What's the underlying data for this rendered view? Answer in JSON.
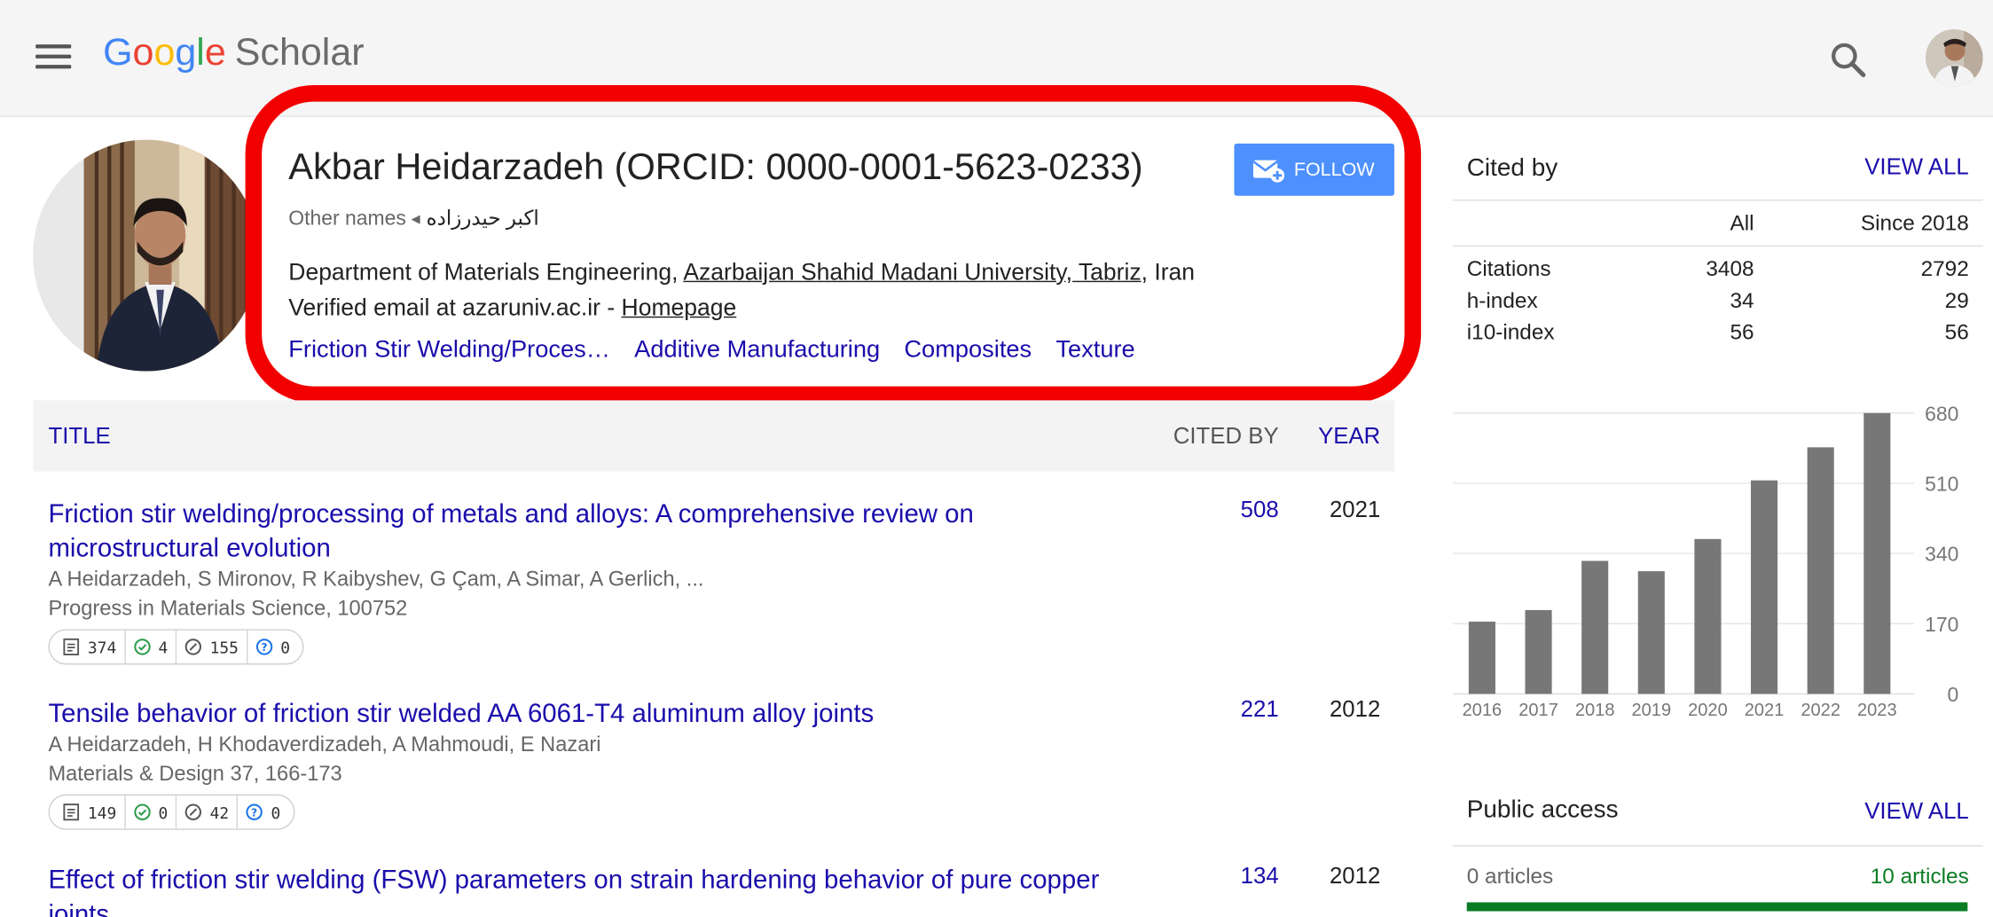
{
  "header": {
    "brand_letters": [
      "G",
      "o",
      "o",
      "g",
      "l",
      "e"
    ],
    "brand_colors": [
      "#4285f4",
      "#ea4335",
      "#fbbc05",
      "#4285f4",
      "#34a853",
      "#ea4335"
    ],
    "product": "Scholar",
    "menu_icon": "hamburger-menu-icon",
    "search_icon": "search-icon",
    "avatar": "user-avatar"
  },
  "profile": {
    "name": "Akbar Heidarzadeh (ORCID: 0000-0001-5623-0233)",
    "follow_label": "FOLLOW",
    "other_names_label": "Other names",
    "other_name": "اکبر حیدرزاده",
    "affiliation_prefix": "Department of Materials Engineering, ",
    "affiliation_link": "Azarbaijan Shahid Madani University, Tabriz",
    "affiliation_suffix": ", Iran",
    "verified_text": "Verified email at azaruniv.ac.ir - ",
    "homepage_label": "Homepage",
    "interests": [
      "Friction Stir Welding/Proces…",
      "Additive Manufacturing",
      "Composites",
      "Texture"
    ],
    "highlight_color": "#f20000"
  },
  "table": {
    "col_title": "TITLE",
    "col_cited": "CITED BY",
    "col_year": "YEAR"
  },
  "articles": [
    {
      "title": "Friction stir welding/processing of metals and alloys: A comprehensive review on microstructural evolution",
      "authors": "A Heidarzadeh, S Mironov, R Kaibyshev, G Çam, A Simar, A Gerlich, ...",
      "journal": "Progress in Materials Science, 100752",
      "cited": "508",
      "year": "2021",
      "badges": [
        "374",
        "4",
        "155",
        "0"
      ]
    },
    {
      "title": "Tensile behavior of friction stir welded AA 6061-T4 aluminum alloy joints",
      "authors": "A Heidarzadeh, H Khodaverdizadeh, A Mahmoudi, E Nazari",
      "journal": "Materials & Design 37, 166-173",
      "cited": "221",
      "year": "2012",
      "badges": [
        "149",
        "0",
        "42",
        "0"
      ]
    },
    {
      "title": "Effect of friction stir welding (FSW) parameters on strain hardening behavior of pure copper joints",
      "authors": "",
      "journal": "",
      "cited": "134",
      "year": "2012",
      "badges": []
    }
  ],
  "cited_by": {
    "title": "Cited by",
    "view_all": "VIEW ALL",
    "col_all": "All",
    "col_since": "Since 2018",
    "rows": [
      {
        "label": "Citations",
        "all": "3408",
        "since": "2792"
      },
      {
        "label": "h-index",
        "all": "34",
        "since": "29"
      },
      {
        "label": "i10-index",
        "all": "56",
        "since": "56"
      }
    ]
  },
  "chart_data": {
    "type": "bar",
    "categories": [
      "2016",
      "2017",
      "2018",
      "2019",
      "2020",
      "2021",
      "2022",
      "2023"
    ],
    "values": [
      175,
      203,
      322,
      297,
      375,
      517,
      597,
      680
    ],
    "y_ticks": [
      "680",
      "510",
      "340",
      "170",
      "0"
    ],
    "ylim": [
      0,
      680
    ],
    "bar_color": "#777777",
    "grid": true
  },
  "public_access": {
    "title": "Public access",
    "view_all": "VIEW ALL",
    "left": "0 articles",
    "right": "10 articles",
    "bar_color": "#0a7d24"
  }
}
